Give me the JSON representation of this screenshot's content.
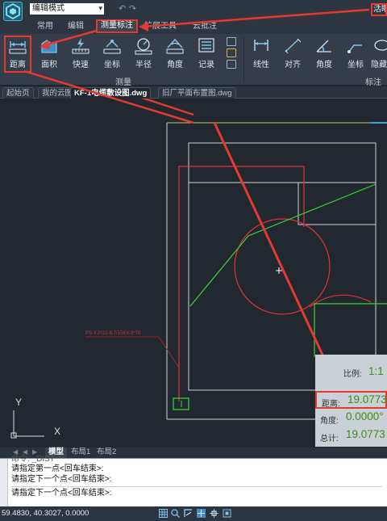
{
  "titlebar": {
    "mode_value": "编辑模式",
    "user_label": "活眼"
  },
  "tabs": [
    "常用",
    "编辑",
    "测量标注",
    "扩展工具",
    "云批注"
  ],
  "ribbon": {
    "measure_tools": [
      "距离",
      "面积",
      "快速",
      "坐标",
      "半径",
      "角度",
      "记录"
    ],
    "annotate_tools": [
      "线性",
      "对齐",
      "角度",
      "坐标",
      "隐藏"
    ],
    "group_measure": "测量",
    "group_annotate": "标注"
  },
  "doc_tabs": [
    "起始页",
    "我的云图",
    "KF-1电缆敷设图.dwg",
    "旧厂平面布置图.dwg"
  ],
  "canvas": {
    "red_text": "PS-YJY22-8.7/15KV-3*70",
    "ucs_y": "Y",
    "ucs_x": "X"
  },
  "measure": {
    "scale_label": "比例:",
    "scale_value": "1:1",
    "distance_label": "距离:",
    "distance_value": "19.0773",
    "angle_label": "角度:",
    "angle_value": "0.0000°",
    "total_label": "总计:",
    "total_value": "19.0773"
  },
  "layout_tabs": [
    "模型",
    "布局1",
    "布局2"
  ],
  "command": {
    "lines": [
      "命令: _DIST",
      "请指定第一点<回车结束>:",
      "请指定下一个点<回车结束>:",
      "请指定下一个点<回车结束>:"
    ]
  },
  "status": {
    "coords": "59.4830, 40.3027, 0.0000"
  },
  "colors": {
    "highlight": "#e23a2f",
    "measure_value": "#3a8d16",
    "canvas_bg": "#212830"
  }
}
